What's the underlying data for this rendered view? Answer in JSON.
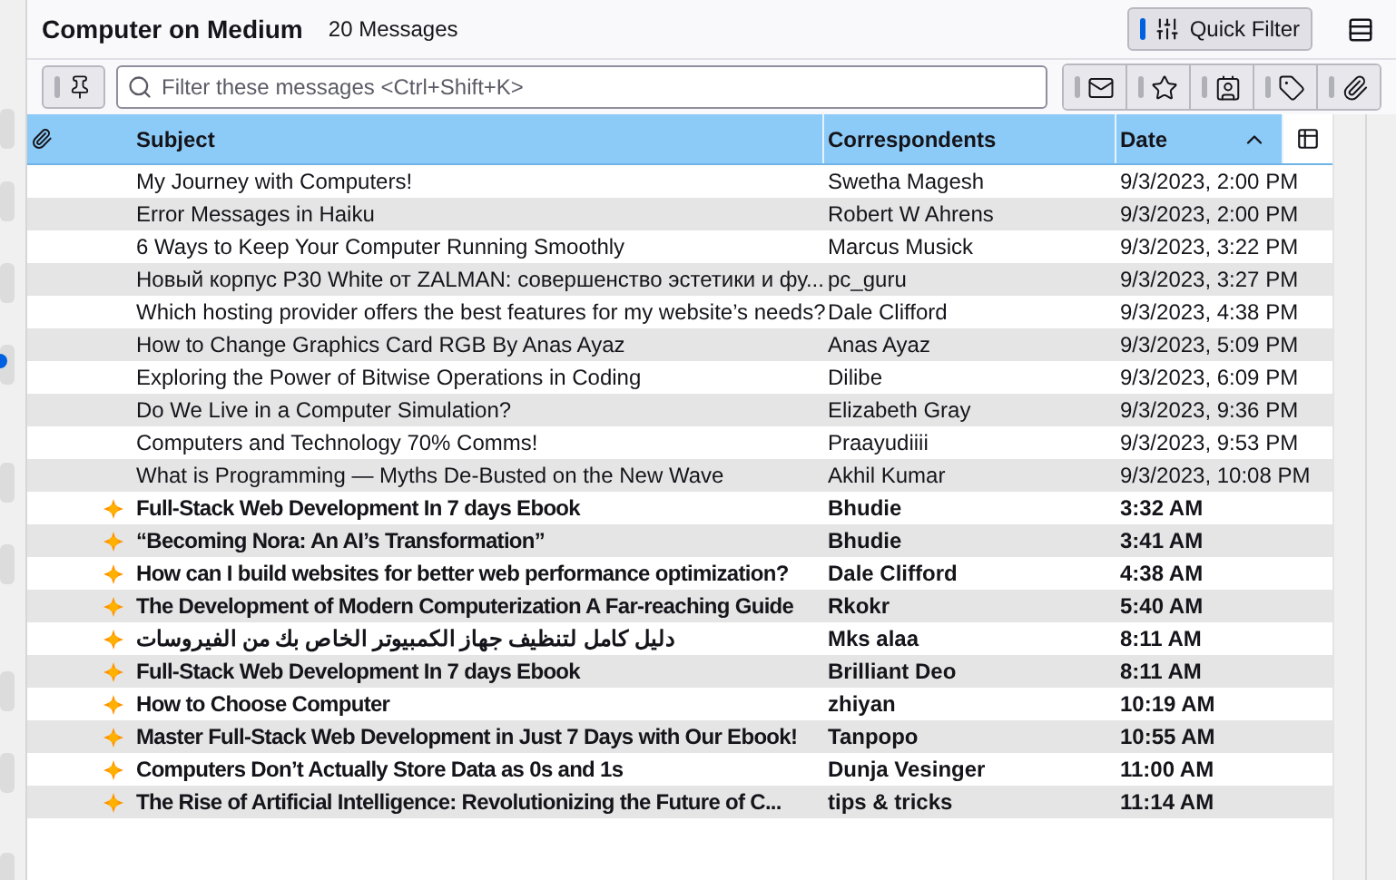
{
  "folder": {
    "title": "Computer on Medium",
    "count": "20 Messages"
  },
  "quick_filter": {
    "label": "Quick Filter",
    "on": true
  },
  "filter": {
    "placeholder": "Filter these messages <Ctrl+Shift+K>",
    "pin_on": false,
    "toggles": [
      {
        "kind": "unread",
        "on": false
      },
      {
        "kind": "starred",
        "on": false
      },
      {
        "kind": "contact",
        "on": false
      },
      {
        "kind": "tags",
        "on": false
      },
      {
        "kind": "attachment",
        "on": false
      }
    ]
  },
  "columns": [
    {
      "kind": "attachment"
    },
    {
      "kind": "thread"
    },
    {
      "kind": "subject",
      "label": "Subject"
    },
    {
      "kind": "correspondents",
      "label": "Correspondents"
    },
    {
      "kind": "date",
      "label": "Date",
      "sort_ascending": true
    },
    {
      "kind": "picker"
    }
  ],
  "rows": [
    {
      "subject": "My Journey with Computers!",
      "correspondent": "Swetha Magesh",
      "date": "9/3/2023, 2:00 PM",
      "unread": false
    },
    {
      "subject": "Error Messages in Haiku",
      "correspondent": "Robert W Ahrens",
      "date": "9/3/2023, 2:00 PM",
      "unread": false
    },
    {
      "subject": "6 Ways to Keep Your Computer Running Smoothly",
      "correspondent": "Marcus Musick",
      "date": "9/3/2023, 3:22 PM",
      "unread": false
    },
    {
      "subject": "Новый корпус P30 White от ZALMAN: совершенство эстетики и фу...",
      "correspondent": "pc_guru",
      "date": "9/3/2023, 3:27 PM",
      "unread": false
    },
    {
      "subject": "Which hosting provider offers the best features for my website’s needs?",
      "correspondent": "Dale Clifford",
      "date": "9/3/2023, 4:38 PM",
      "unread": false
    },
    {
      "subject": "How to Change Graphics Card RGB By Anas Ayaz",
      "correspondent": "Anas Ayaz",
      "date": "9/3/2023, 5:09 PM",
      "unread": false
    },
    {
      "subject": "Exploring the Power of Bitwise Operations in Coding",
      "correspondent": "Dilibe",
      "date": "9/3/2023, 6:09 PM",
      "unread": false
    },
    {
      "subject": "Do We Live in a Computer Simulation?",
      "correspondent": "Elizabeth Gray",
      "date": "9/3/2023, 9:36 PM",
      "unread": false
    },
    {
      "subject": "Computers and Technology 70% Comms!",
      "correspondent": "Praayudiiii",
      "date": "9/3/2023, 9:53 PM",
      "unread": false
    },
    {
      "subject": "What is Programming — Myths De-Busted on the New Wave",
      "correspondent": "Akhil Kumar",
      "date": "9/3/2023, 10:08 PM",
      "unread": false
    },
    {
      "subject": "Full-Stack Web Development In 7 days Ebook",
      "correspondent": "Bhudie",
      "date": "3:32 AM",
      "unread": true
    },
    {
      "subject": "“Becoming Nora: An AI’s Transformation”",
      "correspondent": "Bhudie",
      "date": "3:41 AM",
      "unread": true
    },
    {
      "subject": "How can I build websites for better web performance optimization?",
      "correspondent": "Dale Clifford",
      "date": "4:38 AM",
      "unread": true
    },
    {
      "subject": "The Development of Modern Computerization A Far-reaching Guide",
      "correspondent": "Rkokr",
      "date": "5:40 AM",
      "unread": true
    },
    {
      "subject": "دليل كامل لتنظيف جهاز الكمبيوتر الخاص بك من الفيروسات",
      "correspondent": "Mks alaa",
      "date": "8:11 AM",
      "unread": true
    },
    {
      "subject": "Full-Stack Web Development In 7 days Ebook",
      "correspondent": "Brilliant Deo",
      "date": "8:11 AM",
      "unread": true
    },
    {
      "subject": "How to Choose Computer",
      "correspondent": "zhiyan",
      "date": "10:19 AM",
      "unread": true
    },
    {
      "subject": "Master Full-Stack Web Development in Just 7 Days with Our Ebook!",
      "correspondent": "Tanpopo",
      "date": "10:55 AM",
      "unread": true
    },
    {
      "subject": "Computers Don’t Actually Store Data as 0s and 1s",
      "correspondent": "Dunja Vesinger",
      "date": "11:00 AM",
      "unread": true
    },
    {
      "subject": "The Rise of Artificial Intelligence: Revolutionizing the Future of C...",
      "correspondent": "tips & tricks",
      "date": "11:14 AM",
      "unread": true
    }
  ]
}
